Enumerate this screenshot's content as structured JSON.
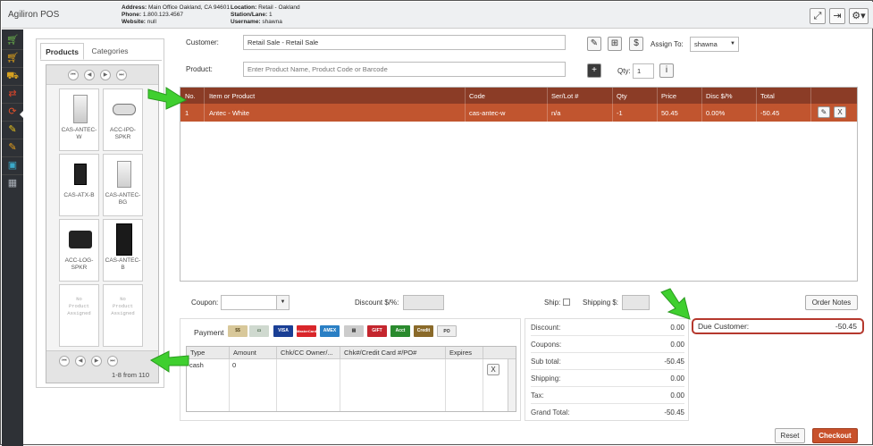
{
  "app": {
    "title": "Agiliron POS"
  },
  "header": {
    "address_label": "Address:",
    "address": "Main Office Oakland, CA 94601",
    "phone_label": "Phone:",
    "phone": "1.800.123.4567",
    "website_label": "Website:",
    "website": "null",
    "location_label": "Location:",
    "location": "Retail - Oakland",
    "station_label": "Station/Lane:",
    "station": "1",
    "username_label": "Username:",
    "username": "shawna",
    "icons": [
      "fullscreen-icon",
      "logout-icon",
      "gear-icon"
    ]
  },
  "sidebar": {
    "icons": [
      "cart-icon",
      "cart-icon",
      "cart-empty-icon",
      "transfer-icon",
      "refresh-icon",
      "edit-icon",
      "edit-icon",
      "money-icon",
      "grid-icon"
    ]
  },
  "products_panel": {
    "tabs": [
      "Products",
      "Categories"
    ],
    "tiles": [
      {
        "code": "CAS-ANTEC-W",
        "lines": [
          "CAS-ANTEC-",
          "W"
        ]
      },
      {
        "code": "ACC-IPD-SPKR",
        "lines": [
          "ACC-IPD-",
          "SPKR"
        ]
      },
      {
        "code": "CAS-ATX-B",
        "lines": [
          "CAS-ATX-B"
        ]
      },
      {
        "code": "CAS-ANTEC-BG",
        "lines": [
          "CAS-ANTEC-",
          "BG"
        ]
      },
      {
        "code": "ACC-LOG-SPKR",
        "lines": [
          "ACC-LOG-",
          "SPKR"
        ]
      },
      {
        "code": "CAS-ANTEC-B",
        "lines": [
          "CAS-ANTEC-",
          "B"
        ]
      },
      {
        "no_product": [
          "No",
          "Product",
          "Assigned"
        ]
      },
      {
        "no_product": [
          "No",
          "Product",
          "Assigned"
        ]
      }
    ],
    "page_info": "1-8 from 110"
  },
  "form": {
    "customer_label": "Customer:",
    "customer_value": "Retail Sale - Retail Sale",
    "product_label": "Product:",
    "product_placeholder": "Enter Product Name, Product Code or Barcode",
    "assign_label": "Assign To:",
    "assign_value": "shawna",
    "qty_label": "Qty:",
    "qty_value": "1"
  },
  "cart": {
    "headers": [
      "No.",
      "Item or Product",
      "Code",
      "Ser/Lot #",
      "Qty",
      "Price",
      "Disc $/%",
      "Total"
    ],
    "rows": [
      {
        "no": "1",
        "item": "Antec - White",
        "code": "cas-antec-w",
        "serial": "n/a",
        "qty": "-1",
        "price": "50.45",
        "disc": "0.00%",
        "total": "-50.45",
        "remove": "X"
      }
    ]
  },
  "discount_row": {
    "coupon_label": "Coupon:",
    "discount_label": "Discount $/%:",
    "ship_label": "Ship:",
    "shipping_label": "Shipping $:",
    "order_notes": "Order Notes"
  },
  "payment": {
    "label": "Payment",
    "methods": [
      "VISA",
      "MasterCard",
      "AMEX",
      "GIFT",
      "Acct",
      "Credit",
      "PO"
    ],
    "headers": [
      "Type",
      "Amount",
      "Chk/CC Owner/...",
      "Chk#/Credit Card #/PO#",
      "Expires"
    ],
    "row": {
      "type": "cash",
      "amount": "0",
      "remove": "X"
    }
  },
  "totals": [
    {
      "label": "Discount:",
      "value": "0.00"
    },
    {
      "label": "Coupons:",
      "value": "0.00"
    },
    {
      "label": "Sub total:",
      "value": "-50.45"
    },
    {
      "label": "Shipping:",
      "value": "0.00"
    },
    {
      "label": "Tax:",
      "value": "0.00"
    },
    {
      "label": "Grand Total:",
      "value": "-50.45"
    }
  ],
  "due": {
    "label": "Due Customer:",
    "value": "-50.45"
  },
  "actions": {
    "reset": "Reset",
    "checkout": "Checkout"
  },
  "colors": {
    "accent": "#c1552f",
    "header_row": "#8b3c26",
    "checkout": "#c8512b",
    "due_border": "#b5382d",
    "arrow": "#3fcf2f"
  }
}
